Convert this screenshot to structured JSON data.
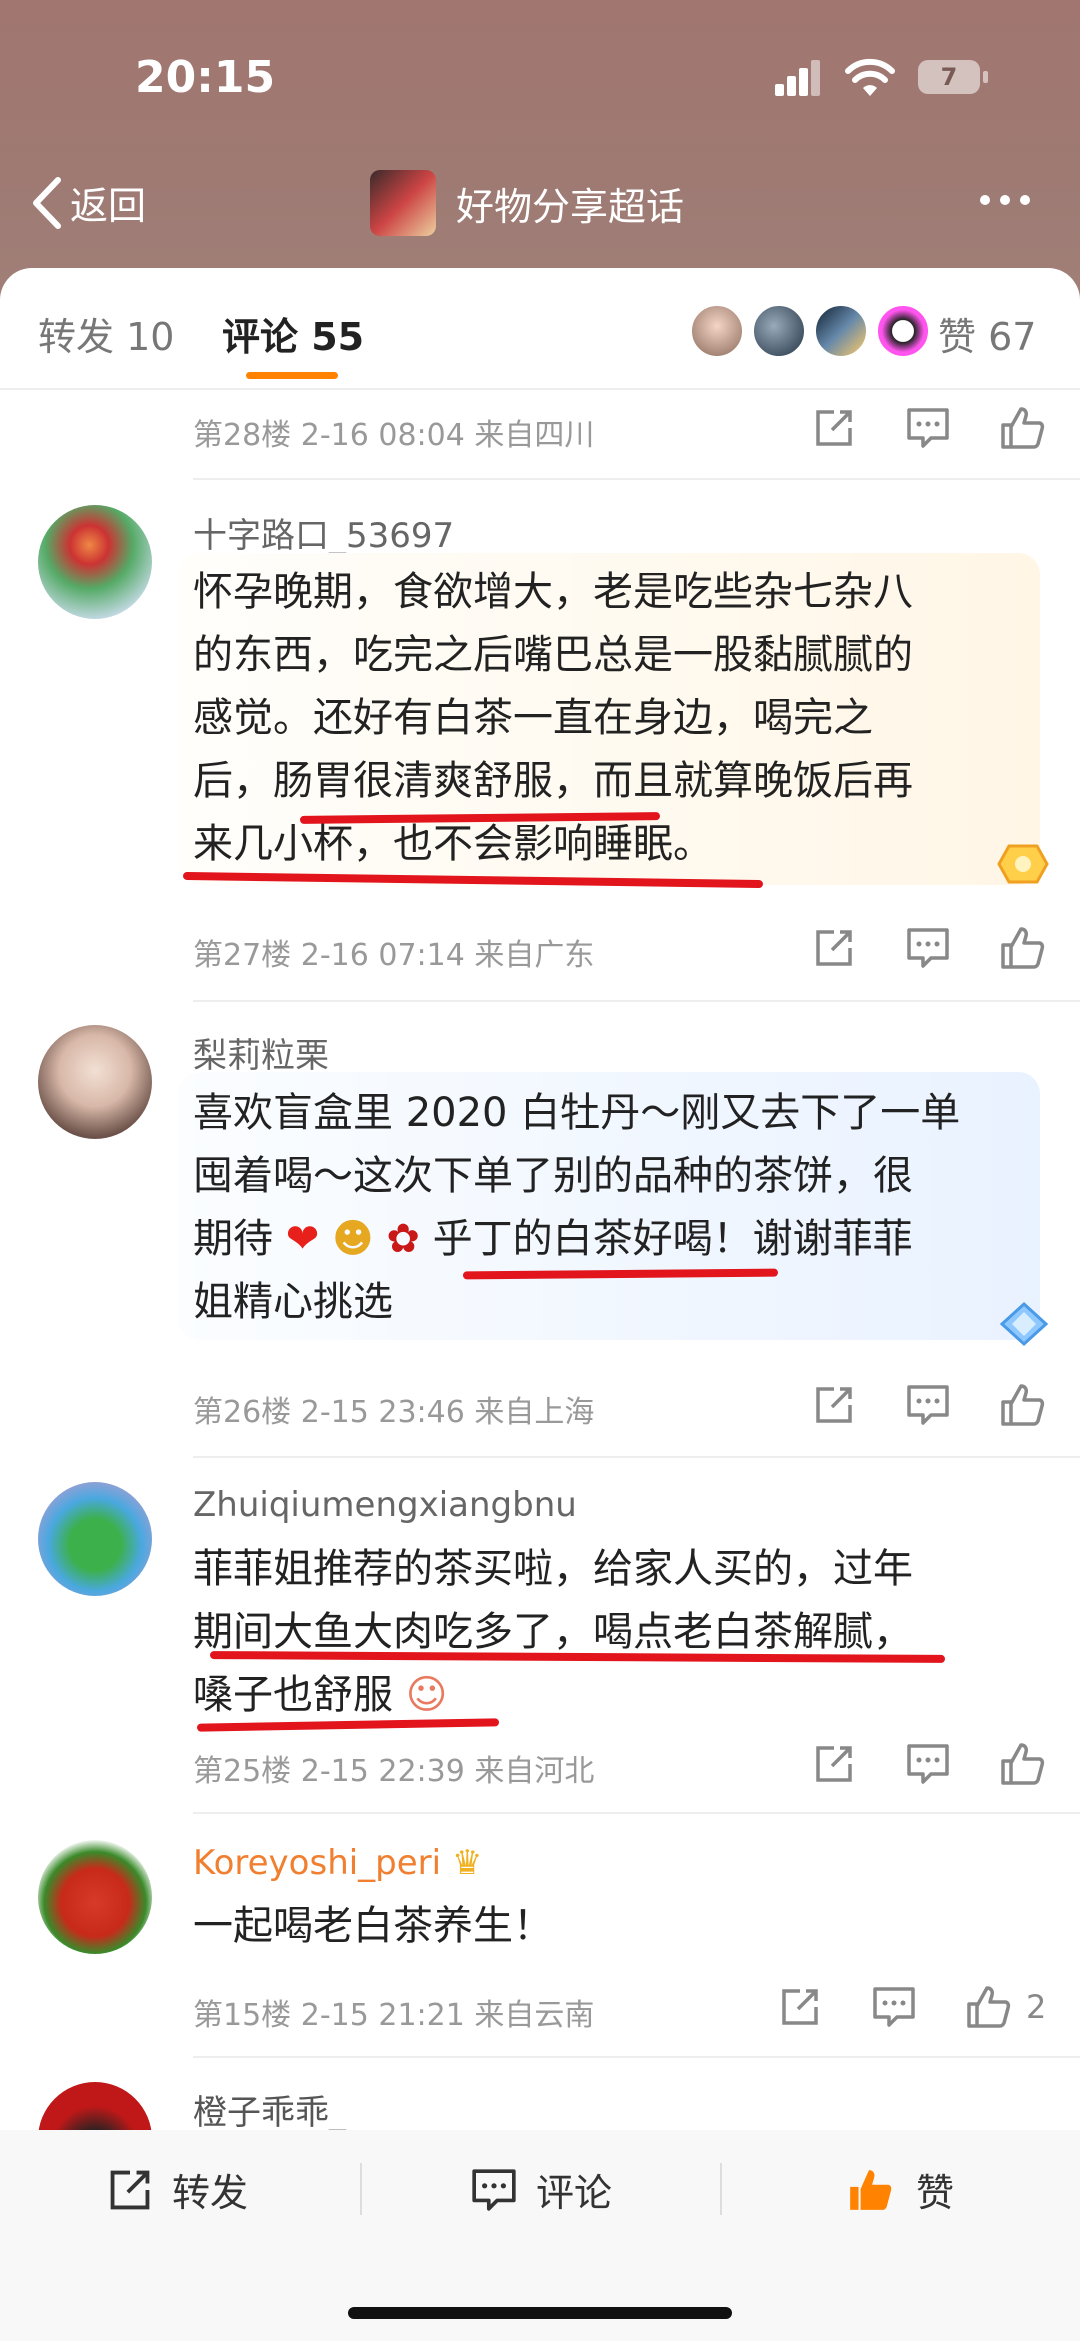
{
  "status_bar": {
    "time": "20:15",
    "battery": "7"
  },
  "header": {
    "back_label": "返回",
    "title": "好物分享超话"
  },
  "tabs": [
    {
      "label": "转发 10"
    },
    {
      "label": "评论 55"
    }
  ],
  "likes": {
    "label": "赞 67"
  },
  "top_meta": {
    "floor": "第28楼",
    "time": "2-16 08:04",
    "location": "来自四川"
  },
  "comments": [
    {
      "username": "十字路口_53697",
      "lines": [
        "怀孕晚期，食欲增大，老是吃些杂七杂八",
        "的东西，吃完之后嘴巴总是一股黏腻腻的",
        "感觉。还好有白茶一直在身边，喝完之",
        "后，肠胃很清爽舒服，而且就算晚饭后再",
        "来几小杯，也不会影响睡眠。"
      ],
      "floor": "第27楼",
      "time": "2-16 07:14",
      "location": "来自广东"
    },
    {
      "username": "梨莉粒栗",
      "lines": [
        "喜欢盲盒里 2020 白牡丹～刚又去下了一单",
        "囤着喝～这次下单了别的品种的茶饼，很",
        "期待",
        "乎丁的白茶好喝！谢谢菲菲",
        "姐精心挑选"
      ],
      "floor": "第26楼",
      "time": "2-15 23:46",
      "location": "来自上海"
    },
    {
      "username": "Zhuiqiumengxiangbnu",
      "lines": [
        "菲菲姐推荐的茶买啦，给家人买的，过年",
        "期间大鱼大肉吃多了，喝点老白茶解腻，",
        "嗓子也舒服"
      ],
      "floor": "第25楼",
      "time": "2-15 22:39",
      "location": "来自河北"
    },
    {
      "username": "Koreyoshi_peri",
      "lines": [
        "一起喝老白茶养生！"
      ],
      "floor": "第15楼",
      "time": "2-15 21:21",
      "location": "来自云南",
      "like_count": "2"
    }
  ],
  "partial_username": "橙子乖乖_",
  "bottom_bar": {
    "repost": "转发",
    "comment": "评论",
    "like": "赞"
  },
  "colors": {
    "accent": "#ff8200",
    "underline": "#e2141c"
  }
}
